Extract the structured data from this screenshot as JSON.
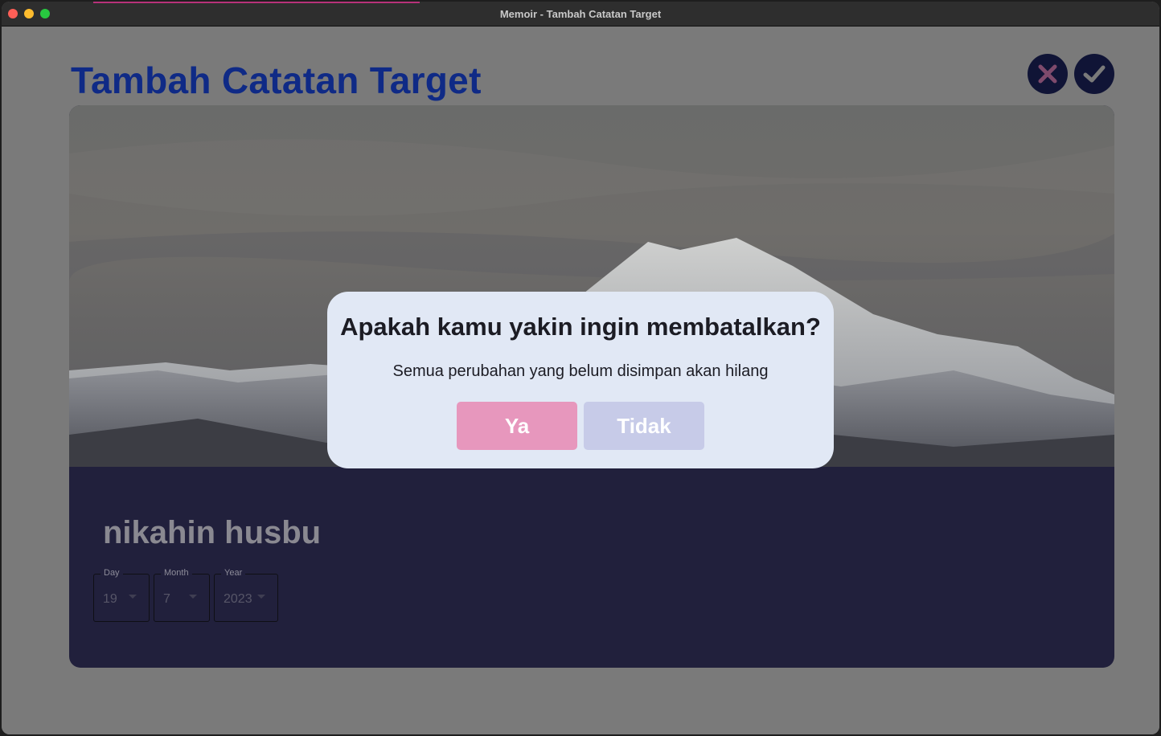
{
  "window": {
    "title": "Memoir - Tambah Catatan Target"
  },
  "page": {
    "title": "Tambah Catatan Target"
  },
  "header_actions": {
    "cancel_icon": "close-x-icon",
    "confirm_icon": "checkmark-icon"
  },
  "hero": {
    "image": "snowy-mountain-landscape"
  },
  "target": {
    "title": "nikahin husbu",
    "date": {
      "day": {
        "label": "Day",
        "value": "19"
      },
      "month": {
        "label": "Month",
        "value": "7"
      },
      "year": {
        "label": "Year",
        "value": "2023"
      }
    }
  },
  "dialog": {
    "title": "Apakah kamu yakin ingin membatalkan?",
    "message": "Semua perubahan yang belum disimpan akan hilang",
    "yes_label": "Ya",
    "no_label": "Tidak"
  },
  "colors": {
    "title_blue": "#0f2a86",
    "card_navy": "#21203c",
    "yes_pink": "#e797bd",
    "no_lavender": "#c7cbe8",
    "dialog_bg": "#e1e8f5"
  }
}
